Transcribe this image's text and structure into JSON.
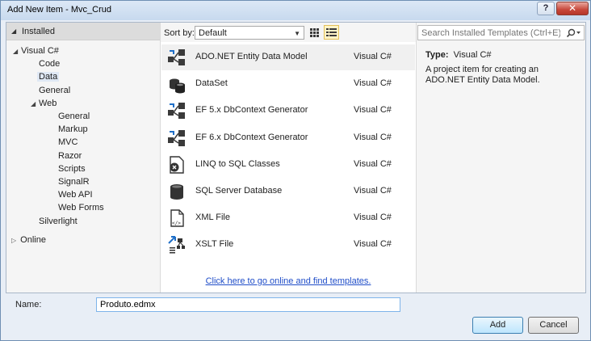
{
  "window": {
    "title": "Add New Item - Mvc_Crud",
    "help_label": "?",
    "close_label": "✕"
  },
  "left_panel": {
    "installed_label": "Installed",
    "tree": [
      {
        "label": "Visual C#",
        "depth": 0,
        "toggle": "◢"
      },
      {
        "label": "Code",
        "depth": 1,
        "toggle": ""
      },
      {
        "label": "Data",
        "depth": 1,
        "toggle": "",
        "selected": true
      },
      {
        "label": "General",
        "depth": 1,
        "toggle": ""
      },
      {
        "label": "Web",
        "depth": 1,
        "toggle": "◢"
      },
      {
        "label": "General",
        "depth": 2,
        "toggle": ""
      },
      {
        "label": "Markup",
        "depth": 2,
        "toggle": ""
      },
      {
        "label": "MVC",
        "depth": 2,
        "toggle": ""
      },
      {
        "label": "Razor",
        "depth": 2,
        "toggle": ""
      },
      {
        "label": "Scripts",
        "depth": 2,
        "toggle": ""
      },
      {
        "label": "SignalR",
        "depth": 2,
        "toggle": ""
      },
      {
        "label": "Web API",
        "depth": 2,
        "toggle": ""
      },
      {
        "label": "Web Forms",
        "depth": 2,
        "toggle": ""
      },
      {
        "label": "Silverlight",
        "depth": 1,
        "toggle": ""
      }
    ],
    "online_label": "Online"
  },
  "toolbar": {
    "sort_label": "Sort by:",
    "sort_value": "Default"
  },
  "templates": [
    {
      "name": "ADO.NET Entity Data Model",
      "lang": "Visual C#",
      "icon": "entity-model-icon",
      "selected": true
    },
    {
      "name": "DataSet",
      "lang": "Visual C#",
      "icon": "dataset-icon"
    },
    {
      "name": "EF 5.x DbContext Generator",
      "lang": "Visual C#",
      "icon": "ef-generator-icon"
    },
    {
      "name": "EF 6.x DbContext Generator",
      "lang": "Visual C#",
      "icon": "ef-generator-icon"
    },
    {
      "name": "LINQ to SQL Classes",
      "lang": "Visual C#",
      "icon": "linq-classes-icon"
    },
    {
      "name": "SQL Server Database",
      "lang": "Visual C#",
      "icon": "database-icon"
    },
    {
      "name": "XML File",
      "lang": "Visual C#",
      "icon": "xml-file-icon"
    },
    {
      "name": "XSLT File",
      "lang": "Visual C#",
      "icon": "xslt-file-icon"
    }
  ],
  "online_link": "Click here to go online and find templates.",
  "search": {
    "placeholder": "Search Installed Templates (Ctrl+E)"
  },
  "details": {
    "type_label": "Type:",
    "type_value": "Visual C#",
    "description": "A project item for creating an ADO.NET Entity Data Model."
  },
  "name_field": {
    "label": "Name:",
    "value": "Produto.edmx"
  },
  "buttons": {
    "add": "Add",
    "cancel": "Cancel"
  },
  "colors": {
    "accent": "#3c7fb1",
    "link": "#1f4dc8",
    "selection": "#dfe8f4"
  }
}
